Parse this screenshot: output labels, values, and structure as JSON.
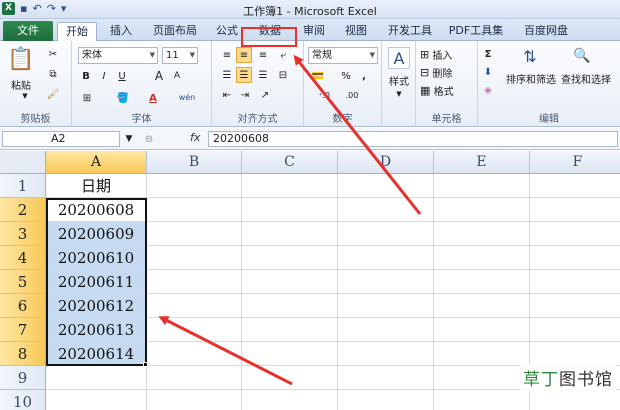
{
  "window": {
    "title": "工作簿1 - Microsoft Excel",
    "app_badge": "X"
  },
  "tabs": {
    "file": "文件",
    "items": [
      "开始",
      "插入",
      "页面布局",
      "公式",
      "数据",
      "审阅",
      "视图",
      "开发工具",
      "PDF工具集",
      "百度网盘"
    ],
    "active": "开始",
    "highlighted": "数据"
  },
  "ribbon": {
    "clipboard": {
      "label": "剪贴板",
      "paste": "粘贴"
    },
    "font": {
      "label": "字体",
      "name": "宋体",
      "size": "11",
      "wen": "wén",
      "bold": "B",
      "italic": "I",
      "underline": "U",
      "grow": "A",
      "shrink": "A",
      "color_a": "A"
    },
    "alignment": {
      "label": "对齐方式"
    },
    "number": {
      "label": "数字",
      "format": "常规",
      "percent": "%",
      "comma": ","
    },
    "styles": {
      "label": "样式",
      "icon": "A"
    },
    "cells": {
      "label": "单元格",
      "insert": "插入",
      "delete": "删除",
      "format": "格式"
    },
    "editing": {
      "label": "编辑",
      "sigma": "Σ",
      "sort": "排序和筛选",
      "find": "查找和选择"
    }
  },
  "formula_bar": {
    "name_box": "A2",
    "fx": "fx",
    "content": "20200608"
  },
  "sheet": {
    "columns": [
      "A",
      "B",
      "C",
      "D",
      "E",
      "F"
    ],
    "rows": [
      "1",
      "2",
      "3",
      "4",
      "5",
      "6",
      "7",
      "8",
      "9",
      "10"
    ],
    "cells_a": [
      "日期",
      "20200608",
      "20200609",
      "20200610",
      "20200611",
      "20200612",
      "20200613",
      "20200614",
      "",
      ""
    ]
  },
  "watermark": {
    "part1": "草丁",
    "part2": "图书馆"
  },
  "colors": {
    "excel_green": "#1e7145",
    "selection": "#c5daf0",
    "header_highlight": "#f7c957",
    "annotation_red": "#e8302c"
  }
}
